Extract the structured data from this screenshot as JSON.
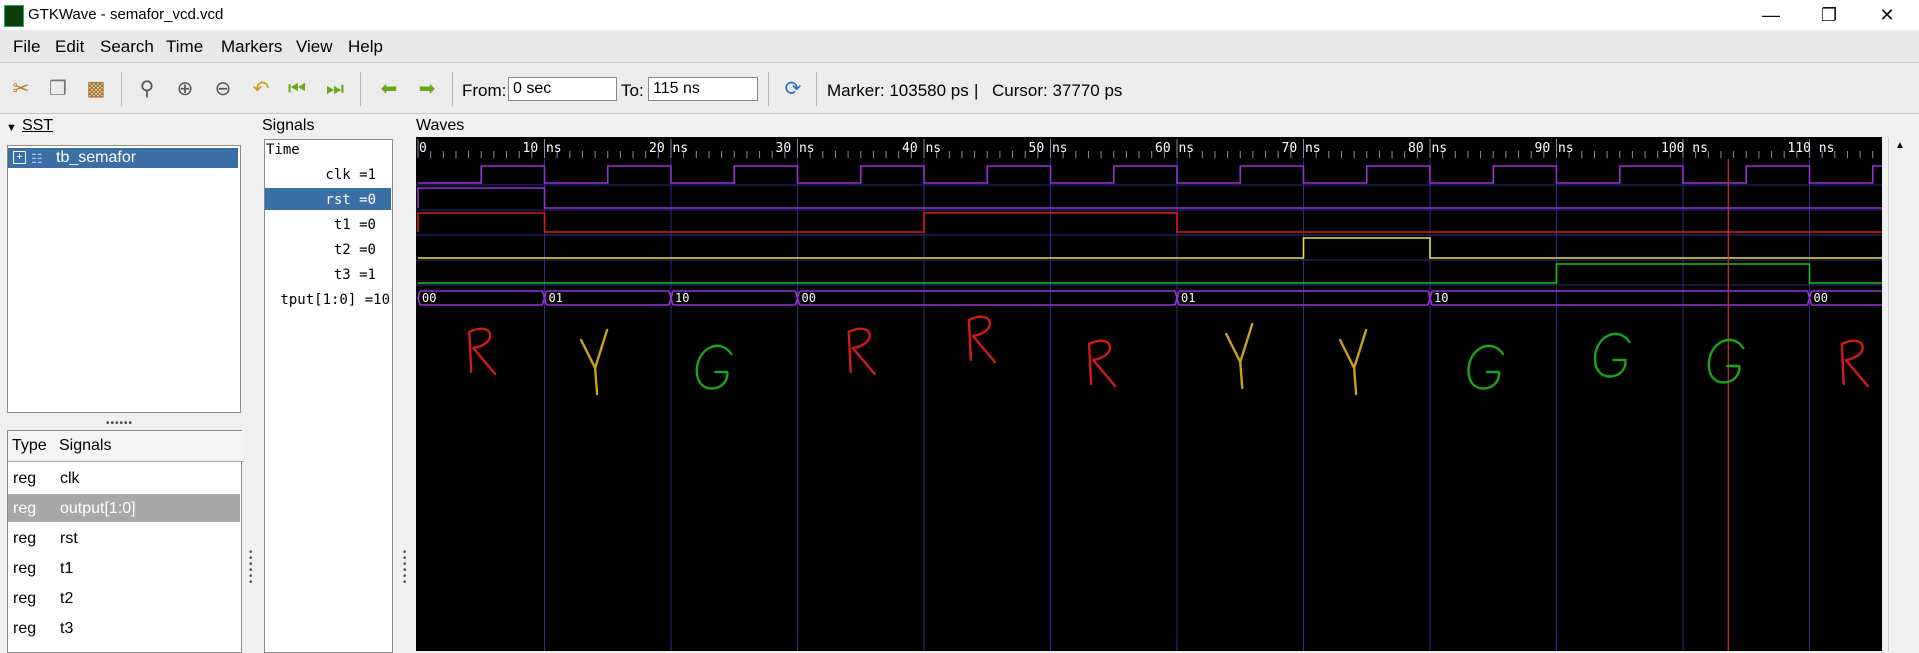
{
  "window": {
    "title": "GTKWave - semafor_vcd.vcd"
  },
  "menu": [
    "File",
    "Edit",
    "Search",
    "Time",
    "Markers",
    "View",
    "Help"
  ],
  "toolbar": {
    "from_label": "From:",
    "from_value": "0 sec",
    "to_label": "To:",
    "to_value": "115 ns",
    "marker_text": "Marker: 103580 ps",
    "separator": "|",
    "cursor_text": "Cursor: 37770 ps",
    "icons": [
      "cut-icon",
      "copy-icon",
      "paste-icon",
      "zoom-fit-icon",
      "zoom-in-icon",
      "zoom-out-icon",
      "undo-zoom-icon",
      "zoom-to-start-icon",
      "zoom-to-end-icon",
      "prev-edge-icon",
      "next-edge-icon",
      "reload-icon"
    ]
  },
  "sst": {
    "title": "SST",
    "tree_item": "tb_semafor",
    "table_headers": {
      "type": "Type",
      "signals": "Signals"
    },
    "rows": [
      {
        "type": "reg",
        "name": "clk"
      },
      {
        "type": "reg",
        "name": "output[1:0]"
      },
      {
        "type": "reg",
        "name": "rst"
      },
      {
        "type": "reg",
        "name": "t1"
      },
      {
        "type": "reg",
        "name": "t2"
      },
      {
        "type": "reg",
        "name": "t3"
      }
    ],
    "selected_row": 1
  },
  "signals_pane": {
    "title": "Signals",
    "header": "Time",
    "items": [
      "clk =1",
      "rst =0",
      "t1 =0",
      "t2 =0",
      "t3 =1",
      "tput[1:0] =10"
    ],
    "selected_index": 1
  },
  "waves": {
    "title": "Waves",
    "time_labels": [
      "0",
      "10 ns",
      "20 ns",
      "30 ns",
      "40 ns",
      "50 ns",
      "60 ns",
      "70 ns",
      "80 ns",
      "90 ns",
      "100 ns",
      "110 ns"
    ],
    "clk_half_period_ns": 5,
    "rst_until_ns": 10,
    "t1_high": [
      [
        0,
        10
      ],
      [
        40,
        60
      ]
    ],
    "t2_high": [
      [
        70,
        80
      ]
    ],
    "t3_high": [
      [
        90,
        110
      ]
    ],
    "bus_segments": [
      {
        "from": 0,
        "to": 10,
        "label": "00"
      },
      {
        "from": 10,
        "to": 20,
        "label": "01"
      },
      {
        "from": 20,
        "to": 30,
        "label": "10"
      },
      {
        "from": 30,
        "to": 60,
        "label": "00"
      },
      {
        "from": 60,
        "to": 80,
        "label": "01"
      },
      {
        "from": 80,
        "to": 110,
        "label": "10"
      },
      {
        "from": 110,
        "to": 116,
        "label": "00"
      }
    ],
    "marker_ns": 103.58,
    "handwritten_letters": [
      {
        "ch": "R",
        "t": 5,
        "color": "#d11a1a"
      },
      {
        "ch": "Y",
        "t": 14,
        "color": "#c8a21a"
      },
      {
        "ch": "G",
        "t": 23.5,
        "color": "#1aa41a"
      },
      {
        "ch": "R",
        "t": 35,
        "color": "#d11a1a"
      },
      {
        "ch": "R",
        "t": 44.5,
        "color": "#d11a1a"
      },
      {
        "ch": "R",
        "t": 54,
        "color": "#d11a1a"
      },
      {
        "ch": "Y",
        "t": 65,
        "color": "#c8a21a"
      },
      {
        "ch": "Y",
        "t": 74,
        "color": "#c8a21a"
      },
      {
        "ch": "G",
        "t": 84.5,
        "color": "#1aa41a"
      },
      {
        "ch": "G",
        "t": 94.5,
        "color": "#1aa41a"
      },
      {
        "ch": "G",
        "t": 103.5,
        "color": "#1aa41a"
      },
      {
        "ch": "R",
        "t": 113.5,
        "color": "#d11a1a"
      }
    ],
    "colors": {
      "clk": "#9b30d9",
      "rst": "#9b30d9",
      "t1": "#e01818",
      "t2": "#e8e040",
      "t3": "#20c020",
      "bus": "#9b30d9",
      "grid": "#2c2c8a",
      "marker": "#d0322a"
    }
  }
}
